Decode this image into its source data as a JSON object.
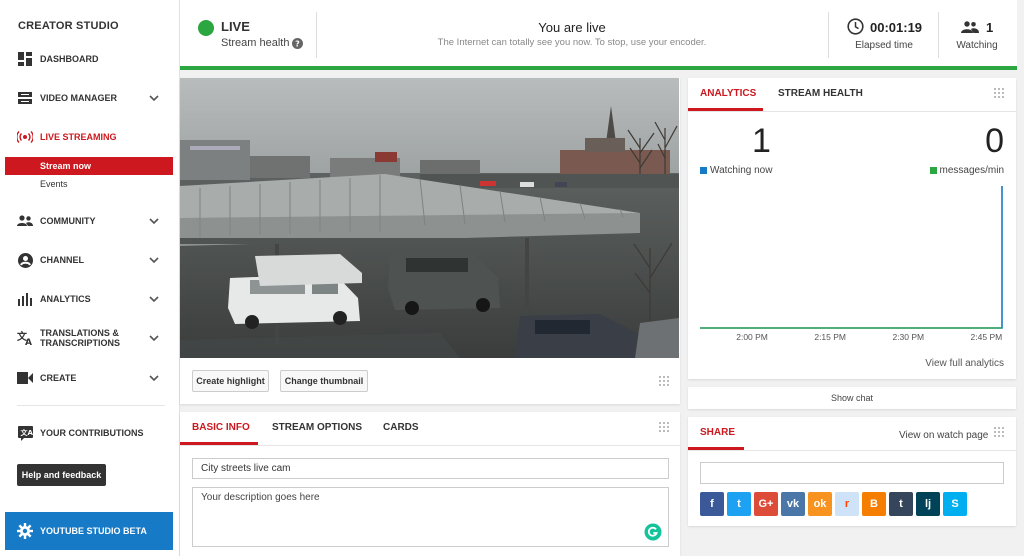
{
  "sidebar": {
    "title": "CREATOR STUDIO",
    "items": [
      {
        "label": "DASHBOARD",
        "icon": "dashboard-icon"
      },
      {
        "label": "VIDEO MANAGER",
        "icon": "video-manager-icon"
      },
      {
        "label": "LIVE STREAMING",
        "icon": "live-streaming-icon"
      },
      {
        "label": "COMMUNITY",
        "icon": "community-icon"
      },
      {
        "label": "CHANNEL",
        "icon": "channel-icon"
      },
      {
        "label": "ANALYTICS",
        "icon": "analytics-icon"
      },
      {
        "label": "TRANSLATIONS &",
        "label2": "TRANSCRIPTIONS",
        "icon": "translations-icon"
      },
      {
        "label": "CREATE",
        "icon": "create-icon"
      },
      {
        "label": "YOUR CONTRIBUTIONS",
        "icon": "contributions-icon"
      }
    ],
    "subitems": [
      {
        "label": "Stream now",
        "active": true
      },
      {
        "label": "Events",
        "active": false
      }
    ],
    "help_label": "Help and feedback",
    "beta_label": "YOUTUBE STUDIO BETA"
  },
  "status": {
    "live_label": "LIVE",
    "health_label": "Stream health",
    "title": "You are live",
    "subtitle": "The Internet can totally see you now. To stop, use your encoder.",
    "elapsed_value": "00:01:19",
    "elapsed_label": "Elapsed time",
    "watching_value": "1",
    "watching_label": "Watching",
    "live_color": "#2ba640"
  },
  "video": {
    "buttons": {
      "highlight": "Create highlight",
      "thumbnail": "Change thumbnail"
    }
  },
  "info": {
    "tabs": [
      "BASIC INFO",
      "STREAM OPTIONS",
      "CARDS"
    ],
    "active_tab": 0,
    "title_value": "City streets live cam",
    "description_placeholder": "Your description goes here"
  },
  "analytics": {
    "tabs": [
      "ANALYTICS",
      "STREAM HEALTH"
    ],
    "active_tab": 0,
    "watching_value": "1",
    "watching_label": "Watching now",
    "messages_value": "0",
    "messages_label": "messages/min",
    "view_full": "View full analytics",
    "accent": "#cc181e"
  },
  "chart_data": {
    "type": "line",
    "x_ticks": [
      "2:00 PM",
      "2:15 PM",
      "2:30 PM",
      "2:45 PM"
    ],
    "series": [
      {
        "name": "Watching now",
        "color": "#167ac6",
        "x": [
          "1:50 PM",
          "2:48 PM",
          "2:48 PM"
        ],
        "values": [
          0,
          0,
          1
        ]
      },
      {
        "name": "messages/min",
        "color": "#2ba640",
        "x": [
          "1:50 PM",
          "2:48 PM"
        ],
        "values": [
          0,
          0
        ]
      }
    ],
    "ylim": [
      0,
      1
    ]
  },
  "chat": {
    "show_label": "Show chat"
  },
  "share": {
    "title": "SHARE",
    "link": "View on watch page",
    "url_value": "",
    "networks": [
      {
        "name": "Facebook",
        "color": "#3b5998",
        "glyph": "f"
      },
      {
        "name": "Twitter",
        "color": "#1da1f2",
        "glyph": "t"
      },
      {
        "name": "Google+",
        "color": "#dd4b39",
        "glyph": "G+"
      },
      {
        "name": "VK",
        "color": "#4a76a8",
        "glyph": "vk"
      },
      {
        "name": "Odnoklassniki",
        "color": "#f7931e",
        "glyph": "ok"
      },
      {
        "name": "Reddit",
        "color": "#cee3f8",
        "glyph": "r"
      },
      {
        "name": "Blogger",
        "color": "#f57d00",
        "glyph": "B"
      },
      {
        "name": "Tumblr",
        "color": "#35465c",
        "glyph": "t"
      },
      {
        "name": "LiveJournal",
        "color": "#004359",
        "glyph": "lj"
      },
      {
        "name": "Skype",
        "color": "#00aff0",
        "glyph": "S"
      }
    ]
  }
}
